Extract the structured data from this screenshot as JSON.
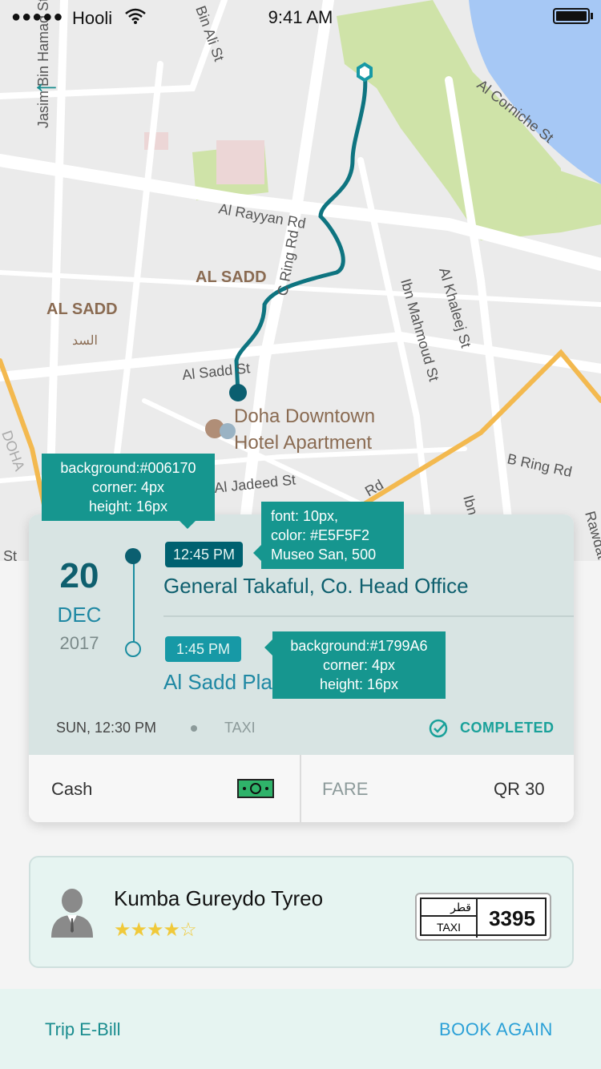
{
  "status_bar": {
    "signal": "●●●●●",
    "carrier": "Hooli",
    "time": "9:41 AM"
  },
  "map": {
    "labels": {
      "jasim": "Jasim Bin Hamad St",
      "bin_ali": "Bin Ali St",
      "corniche": "Al Corniche St",
      "rayyan": "Al Rayyan Rd",
      "c_ring": "C Ring Rd",
      "al_sadd_center": "AL SADD",
      "al_sadd_left": "AL SADD",
      "al_sadd_ar": "السد",
      "ibn_mahmoud": "Ibn Mahmoud St",
      "al_khaleej": "Al Khaleej St",
      "al_sadd_st": "Al Sadd St",
      "b_ring": "B Ring Rd",
      "al_jadeed": "Al Jadeed St",
      "doha_left": "DOHA",
      "rd": "Rd",
      "ibn": "Ibn",
      "st": "St",
      "rawdat": "Rawdat Al"
    },
    "poi_line1": "Doha Downtown",
    "poi_line2": "Hotel Apartment"
  },
  "trip": {
    "day": "20",
    "month": "DEC",
    "year": "2017",
    "pickup_time": "12:45 PM",
    "pickup_place": "General Takaful, Co. Head Office",
    "dropoff_time": "1:45 PM",
    "dropoff_place": "Al Sadd Pla",
    "datetime": "SUN, 12:30 PM",
    "mode": "TAXI",
    "status": "COMPLETED",
    "payment": "Cash",
    "fare_label": "FARE",
    "fare_value": "QR 30"
  },
  "driver": {
    "name": "Kumba Gureydo Tyreo",
    "rating_stars": "★★★★☆",
    "rating": 4.5,
    "plate_arabic": "قطر",
    "plate_type": "TAXI",
    "plate_number": "3395"
  },
  "footer": {
    "ebill": "Trip E-Bill",
    "book_again": "BOOK AGAIN"
  },
  "annotations": {
    "note1": [
      "background:#006170",
      "corner: 4px",
      "height: 16px"
    ],
    "note2": [
      "font: 10px,",
      "color: #E5F5F2",
      "Museo San, 500"
    ],
    "note3": [
      "background:#1799A6",
      "corner: 4px",
      "height: 16px"
    ]
  },
  "colors": {
    "accent": "#1799A6",
    "dark_teal": "#006170",
    "text_light": "#E5F5F2",
    "completed": "#1AA19A",
    "book_again": "#2BA0D7"
  }
}
